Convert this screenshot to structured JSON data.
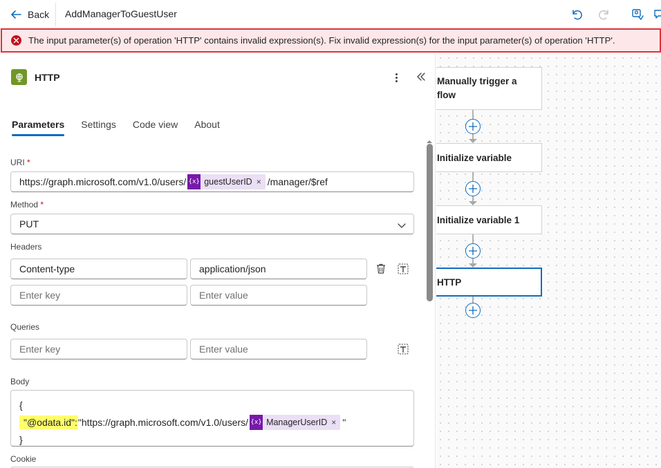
{
  "topbar": {
    "back_label": "Back",
    "flow_title": "AddManagerToGuestUser"
  },
  "error": {
    "message": "The input parameter(s) of operation 'HTTP' contains invalid expression(s). Fix invalid expression(s) for the input parameter(s) of operation 'HTTP'."
  },
  "panel": {
    "title": "HTTP",
    "tabs": [
      {
        "label": "Parameters",
        "active": true
      },
      {
        "label": "Settings",
        "active": false
      },
      {
        "label": "Code view",
        "active": false
      },
      {
        "label": "About",
        "active": false
      }
    ],
    "uri": {
      "label": "URI",
      "required_mark": "*",
      "prefix": "https://graph.microsoft.com/v1.0/users/",
      "token_icon": "{x}",
      "token_label": "guestUserID",
      "token_remove": "×",
      "suffix": "/manager/$ref"
    },
    "method": {
      "label": "Method",
      "required_mark": "*",
      "value": "PUT"
    },
    "headers": {
      "label": "Headers",
      "rows": [
        {
          "key": "Content-type",
          "value": "application/json"
        }
      ],
      "key_placeholder": "Enter key",
      "value_placeholder": "Enter value"
    },
    "queries": {
      "label": "Queries",
      "key_placeholder": "Enter key",
      "value_placeholder": "Enter value"
    },
    "body": {
      "label": "Body",
      "line1": "{",
      "key_highlight": "\"@odata.id\":",
      "value_prefix": " \"https://graph.microsoft.com/v1.0/users/",
      "token_icon": "{x}",
      "token_label": "ManagerUserID",
      "token_remove": "×",
      "value_suffix": " \"",
      "line3": "}"
    },
    "cookie": {
      "label": "Cookie"
    }
  },
  "canvas": {
    "nodes": [
      {
        "label": "Manually trigger a flow"
      },
      {
        "label": "Initialize variable"
      },
      {
        "label": "Initialize variable 1"
      },
      {
        "label": "HTTP",
        "selected": true
      }
    ]
  },
  "colors": {
    "accent": "#0f6cbd",
    "error_border": "#e0303a",
    "error_bg": "#fde7e9",
    "token_purple": "#7719aa",
    "http_green": "#709727",
    "highlight": "#fffe6b"
  }
}
